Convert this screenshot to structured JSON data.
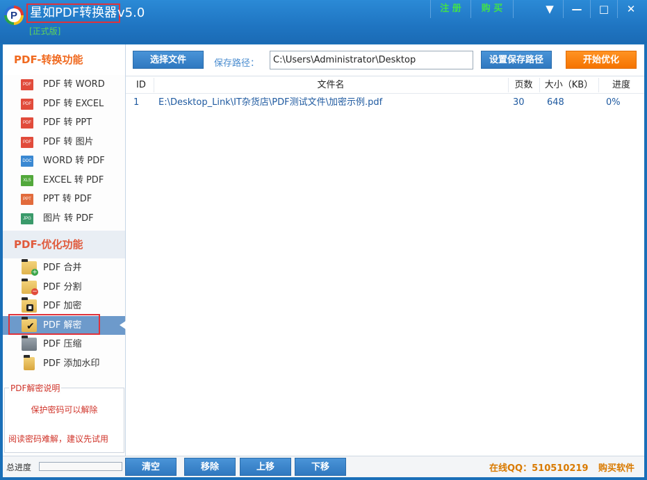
{
  "title_bar": {
    "logo_letter": "P",
    "app_name": "星如PDF转换器",
    "version": "v5.0",
    "edition": "[正式版]",
    "register_label": "注 册",
    "buy_label": "购 买",
    "window_controls": {
      "menu": "▼",
      "minimize": "—",
      "maximize": "□",
      "close": "✕"
    }
  },
  "sidebar": {
    "convert_title": "PDF-转换功能",
    "convert_items": [
      {
        "label": "PDF 转 WORD",
        "icon": "pdf-file-icon",
        "icon_text": "PDF"
      },
      {
        "label": "PDF 转 EXCEL",
        "icon": "pdf-file-icon",
        "icon_text": "PDF"
      },
      {
        "label": "PDF 转 PPT",
        "icon": "pdf-file-icon",
        "icon_text": "PDF"
      },
      {
        "label": "PDF 转 图片",
        "icon": "pdf-file-icon",
        "icon_text": "PDF"
      },
      {
        "label": "WORD 转 PDF",
        "icon": "doc-file-icon",
        "icon_text": "DOC"
      },
      {
        "label": "EXCEL 转 PDF",
        "icon": "xls-file-icon",
        "icon_text": "XLS"
      },
      {
        "label": "PPT 转 PDF",
        "icon": "ppt-file-icon",
        "icon_text": "PPT"
      },
      {
        "label": "图片 转 PDF",
        "icon": "jpg-file-icon",
        "icon_text": "JPG"
      }
    ],
    "optimize_title": "PDF-优化功能",
    "optimize_items": [
      {
        "label": "PDF 合并",
        "icon": "folder-plus-icon"
      },
      {
        "label": "PDF 分割",
        "icon": "folder-minus-icon"
      },
      {
        "label": "PDF 加密",
        "icon": "folder-lock-icon"
      },
      {
        "label": "PDF 解密",
        "icon": "folder-check-icon",
        "active": true
      },
      {
        "label": "PDF 压缩",
        "icon": "compress-icon"
      },
      {
        "label": "PDF 添加水印",
        "icon": "watermark-icon"
      }
    ],
    "description": {
      "title": "PDF解密说明",
      "line1": "保护密码可以解除",
      "line2": "阅读密码难解，建议先试用"
    }
  },
  "toolbar": {
    "select_file_label": "选择文件",
    "save_path_label": "保存路径：",
    "save_path_value": "C:\\Users\\Administrator\\Desktop",
    "set_path_label": "设置保存路径",
    "start_label": "开始优化"
  },
  "table": {
    "headers": {
      "id": "ID",
      "filename": "文件名",
      "pages": "页数",
      "size": "大小（KB）",
      "progress": "进度"
    },
    "rows": [
      {
        "id": "1",
        "filename": "E:\\Desktop_Link\\IT杂货店\\PDF测试文件\\加密示例.pdf",
        "pages": "30",
        "size": "648",
        "progress": "0%"
      }
    ]
  },
  "bottom": {
    "total_progress_label": "总进度",
    "total_progress_value": 0,
    "clear_label": "清空",
    "remove_label": "移除",
    "move_up_label": "上移",
    "move_down_label": "下移",
    "qq_text": "在线QQ：510510219",
    "buy_software": "购买软件"
  },
  "colors": {
    "titlebar": "#1f75c2",
    "accent_orange": "#f57300",
    "button_blue": "#2f78c0",
    "highlight_red": "#e0323a",
    "active_item": "#6d9acb"
  }
}
